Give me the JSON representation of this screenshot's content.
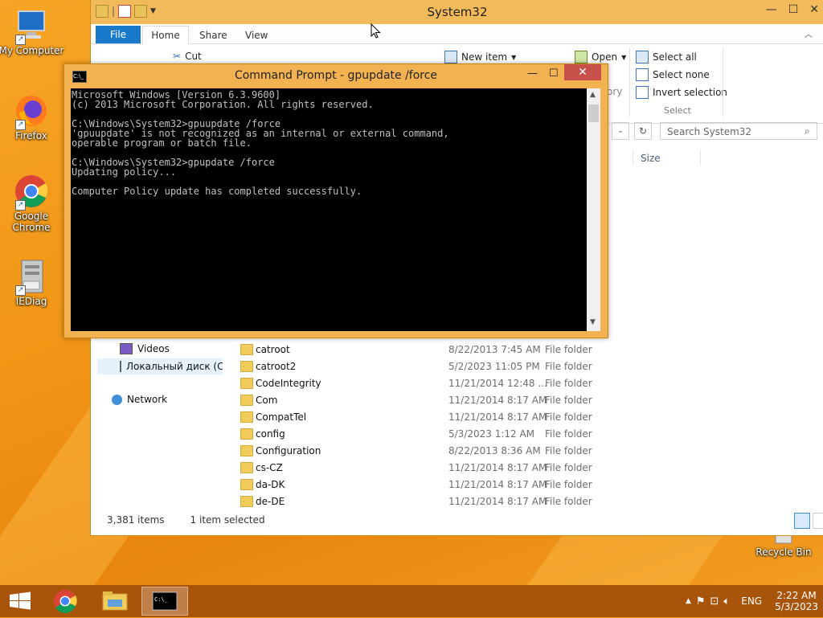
{
  "desktop": {
    "icons": [
      {
        "label": "My Computer",
        "icon": "computer-icon"
      },
      {
        "label": "Firefox",
        "icon": "firefox-icon"
      },
      {
        "label": "Google Chrome",
        "icon": "chrome-icon"
      },
      {
        "label": "IEDiag",
        "icon": "program-icon"
      },
      {
        "label": "Recycle Bin",
        "icon": "recycle-bin-icon"
      }
    ]
  },
  "explorer": {
    "title": "System32",
    "tabs": [
      "File",
      "Home",
      "Share",
      "View"
    ],
    "ribbon": {
      "cut": "Cut",
      "new_item": "New item",
      "open": "Open",
      "history_partial": "ory",
      "select_all": "Select all",
      "select_none": "Select none",
      "invert_selection": "Invert selection",
      "select_group": "Select"
    },
    "search_placeholder": "Search System32",
    "column_size": "Size",
    "nav": {
      "videos": "Videos",
      "local_disk": "Локальный диск (C",
      "network": "Network"
    },
    "files": [
      {
        "name": "catroot",
        "date": "8/22/2013 7:45 AM",
        "type": "File folder"
      },
      {
        "name": "catroot2",
        "date": "5/2/2023 11:05 PM",
        "type": "File folder"
      },
      {
        "name": "CodeIntegrity",
        "date": "11/21/2014 12:48 ...",
        "type": "File folder"
      },
      {
        "name": "Com",
        "date": "11/21/2014 8:17 AM",
        "type": "File folder"
      },
      {
        "name": "CompatTel",
        "date": "11/21/2014 8:17 AM",
        "type": "File folder"
      },
      {
        "name": "config",
        "date": "5/3/2023 1:12 AM",
        "type": "File folder"
      },
      {
        "name": "Configuration",
        "date": "8/22/2013 8:36 AM",
        "type": "File folder"
      },
      {
        "name": "cs-CZ",
        "date": "11/21/2014 8:17 AM",
        "type": "File folder"
      },
      {
        "name": "da-DK",
        "date": "11/21/2014 8:17 AM",
        "type": "File folder"
      },
      {
        "name": "de-DE",
        "date": "11/21/2014 8:17 AM",
        "type": "File folder"
      }
    ],
    "status": {
      "items": "3,381 items",
      "selected": "1 item selected"
    }
  },
  "cmd": {
    "title": "Command Prompt - gpupdate  /force",
    "lines": [
      "Microsoft Windows [Version 6.3.9600]",
      "(c) 2013 Microsoft Corporation. All rights reserved.",
      "",
      "C:\\Windows\\System32>gpuupdate /force",
      "'gpuupdate' is not recognized as an internal or external command,",
      "operable program or batch file.",
      "",
      "C:\\Windows\\System32>gpupdate /force",
      "Updating policy...",
      "",
      "Computer Policy update has completed successfully."
    ]
  },
  "taskbar": {
    "lang": "ENG",
    "time": "2:22 AM",
    "date": "5/3/2023"
  }
}
